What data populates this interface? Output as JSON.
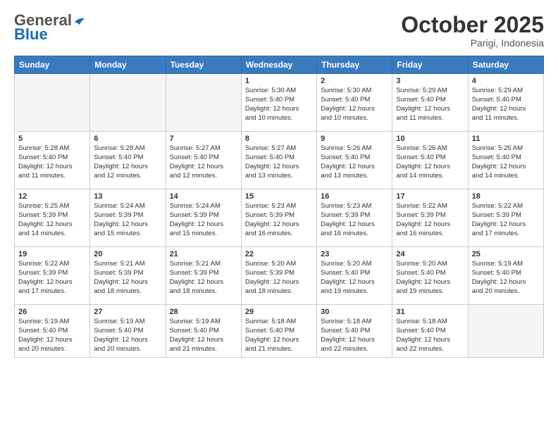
{
  "header": {
    "logo_general": "General",
    "logo_blue": "Blue",
    "month": "October 2025",
    "location": "Parigi, Indonesia"
  },
  "weekdays": [
    "Sunday",
    "Monday",
    "Tuesday",
    "Wednesday",
    "Thursday",
    "Friday",
    "Saturday"
  ],
  "weeks": [
    [
      {
        "day": "",
        "info": ""
      },
      {
        "day": "",
        "info": ""
      },
      {
        "day": "",
        "info": ""
      },
      {
        "day": "1",
        "info": "Sunrise: 5:30 AM\nSunset: 5:40 PM\nDaylight: 12 hours\nand 10 minutes."
      },
      {
        "day": "2",
        "info": "Sunrise: 5:30 AM\nSunset: 5:40 PM\nDaylight: 12 hours\nand 10 minutes."
      },
      {
        "day": "3",
        "info": "Sunrise: 5:29 AM\nSunset: 5:40 PM\nDaylight: 12 hours\nand 11 minutes."
      },
      {
        "day": "4",
        "info": "Sunrise: 5:29 AM\nSunset: 5:40 PM\nDaylight: 12 hours\nand 11 minutes."
      }
    ],
    [
      {
        "day": "5",
        "info": "Sunrise: 5:28 AM\nSunset: 5:40 PM\nDaylight: 12 hours\nand 11 minutes."
      },
      {
        "day": "6",
        "info": "Sunrise: 5:28 AM\nSunset: 5:40 PM\nDaylight: 12 hours\nand 12 minutes."
      },
      {
        "day": "7",
        "info": "Sunrise: 5:27 AM\nSunset: 5:40 PM\nDaylight: 12 hours\nand 12 minutes."
      },
      {
        "day": "8",
        "info": "Sunrise: 5:27 AM\nSunset: 5:40 PM\nDaylight: 12 hours\nand 13 minutes."
      },
      {
        "day": "9",
        "info": "Sunrise: 5:26 AM\nSunset: 5:40 PM\nDaylight: 12 hours\nand 13 minutes."
      },
      {
        "day": "10",
        "info": "Sunrise: 5:26 AM\nSunset: 5:40 PM\nDaylight: 12 hours\nand 14 minutes."
      },
      {
        "day": "11",
        "info": "Sunrise: 5:25 AM\nSunset: 5:40 PM\nDaylight: 12 hours\nand 14 minutes."
      }
    ],
    [
      {
        "day": "12",
        "info": "Sunrise: 5:25 AM\nSunset: 5:39 PM\nDaylight: 12 hours\nand 14 minutes."
      },
      {
        "day": "13",
        "info": "Sunrise: 5:24 AM\nSunset: 5:39 PM\nDaylight: 12 hours\nand 15 minutes."
      },
      {
        "day": "14",
        "info": "Sunrise: 5:24 AM\nSunset: 5:39 PM\nDaylight: 12 hours\nand 15 minutes."
      },
      {
        "day": "15",
        "info": "Sunrise: 5:23 AM\nSunset: 5:39 PM\nDaylight: 12 hours\nand 16 minutes."
      },
      {
        "day": "16",
        "info": "Sunrise: 5:23 AM\nSunset: 5:39 PM\nDaylight: 12 hours\nand 16 minutes."
      },
      {
        "day": "17",
        "info": "Sunrise: 5:22 AM\nSunset: 5:39 PM\nDaylight: 12 hours\nand 16 minutes."
      },
      {
        "day": "18",
        "info": "Sunrise: 5:22 AM\nSunset: 5:39 PM\nDaylight: 12 hours\nand 17 minutes."
      }
    ],
    [
      {
        "day": "19",
        "info": "Sunrise: 5:22 AM\nSunset: 5:39 PM\nDaylight: 12 hours\nand 17 minutes."
      },
      {
        "day": "20",
        "info": "Sunrise: 5:21 AM\nSunset: 5:39 PM\nDaylight: 12 hours\nand 18 minutes."
      },
      {
        "day": "21",
        "info": "Sunrise: 5:21 AM\nSunset: 5:39 PM\nDaylight: 12 hours\nand 18 minutes."
      },
      {
        "day": "22",
        "info": "Sunrise: 5:20 AM\nSunset: 5:39 PM\nDaylight: 12 hours\nand 18 minutes."
      },
      {
        "day": "23",
        "info": "Sunrise: 5:20 AM\nSunset: 5:40 PM\nDaylight: 12 hours\nand 19 minutes."
      },
      {
        "day": "24",
        "info": "Sunrise: 5:20 AM\nSunset: 5:40 PM\nDaylight: 12 hours\nand 19 minutes."
      },
      {
        "day": "25",
        "info": "Sunrise: 5:19 AM\nSunset: 5:40 PM\nDaylight: 12 hours\nand 20 minutes."
      }
    ],
    [
      {
        "day": "26",
        "info": "Sunrise: 5:19 AM\nSunset: 5:40 PM\nDaylight: 12 hours\nand 20 minutes."
      },
      {
        "day": "27",
        "info": "Sunrise: 5:19 AM\nSunset: 5:40 PM\nDaylight: 12 hours\nand 20 minutes."
      },
      {
        "day": "28",
        "info": "Sunrise: 5:19 AM\nSunset: 5:40 PM\nDaylight: 12 hours\nand 21 minutes."
      },
      {
        "day": "29",
        "info": "Sunrise: 5:18 AM\nSunset: 5:40 PM\nDaylight: 12 hours\nand 21 minutes."
      },
      {
        "day": "30",
        "info": "Sunrise: 5:18 AM\nSunset: 5:40 PM\nDaylight: 12 hours\nand 22 minutes."
      },
      {
        "day": "31",
        "info": "Sunrise: 5:18 AM\nSunset: 5:40 PM\nDaylight: 12 hours\nand 22 minutes."
      },
      {
        "day": "",
        "info": ""
      }
    ]
  ]
}
